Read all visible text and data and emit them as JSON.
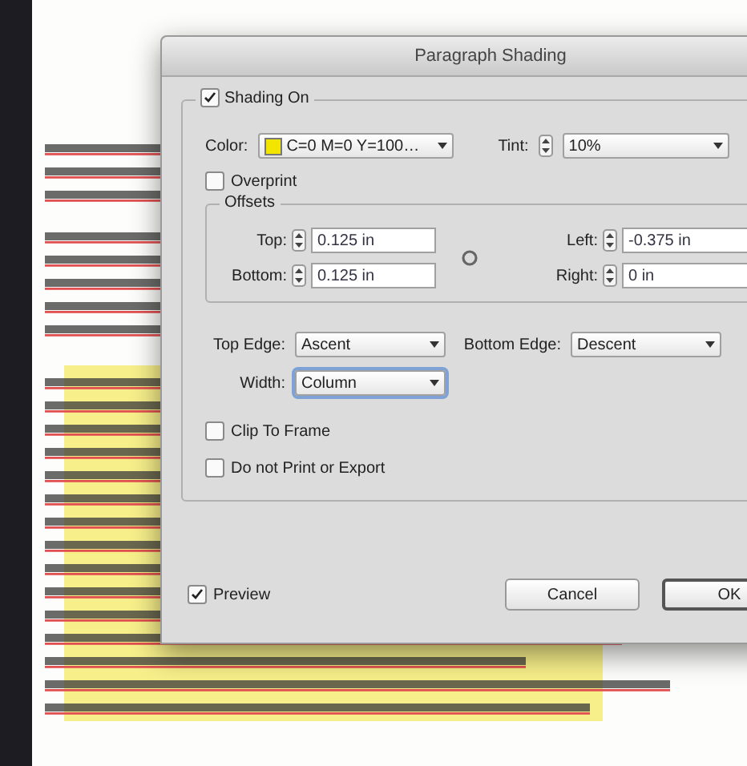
{
  "window": {
    "title": "Paragraph Shading"
  },
  "shading": {
    "label": "Shading On",
    "checked": true
  },
  "color": {
    "label": "Color:",
    "value": "C=0 M=0 Y=100…",
    "color": "#f2e600"
  },
  "tint": {
    "label": "Tint:",
    "value": "10%"
  },
  "overprint": {
    "label": "Overprint",
    "checked": false
  },
  "offsets": {
    "title": "Offsets",
    "fields": [
      {
        "label": "Top:",
        "value": "0.125 in"
      },
      {
        "label": "Left:",
        "value": "-0.375 in"
      },
      {
        "label": "Bottom:",
        "value": "0.125 in"
      },
      {
        "label": "Right:",
        "value": "0 in"
      }
    ]
  },
  "edges": [
    {
      "label": "Top Edge:",
      "value": "Ascent"
    },
    {
      "label": "Bottom Edge:",
      "value": "Descent"
    }
  ],
  "width": {
    "label": "Width:",
    "value": "Column",
    "focused": true
  },
  "options": [
    {
      "label": "Clip To Frame",
      "checked": false
    },
    {
      "label": "Do not Print or Export",
      "checked": false
    }
  ],
  "preview": {
    "label": "Preview",
    "checked": true
  },
  "buttons": [
    {
      "label": "Cancel",
      "default": false
    },
    {
      "label": "OK",
      "default": true
    }
  ]
}
